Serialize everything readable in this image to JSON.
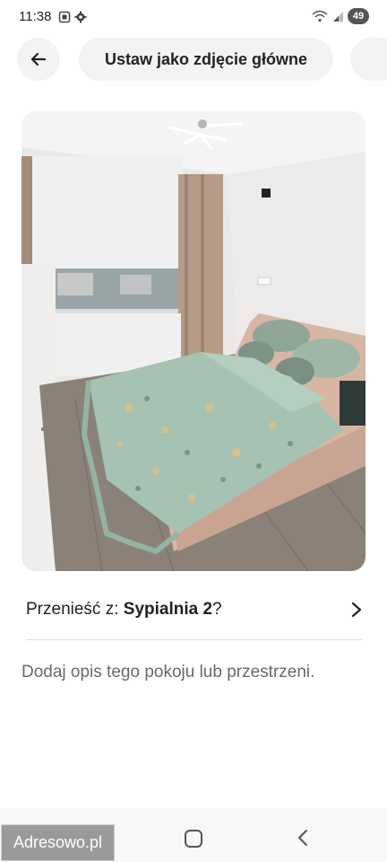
{
  "status": {
    "time": "11:38",
    "battery": "49"
  },
  "toolbar": {
    "main_button_label": "Ustaw jako zdjęcie główne"
  },
  "move": {
    "prefix": "Przenieść z: ",
    "room": "Sypialnia 2",
    "suffix": "?"
  },
  "description_prompt": "Dodaj opis tego pokoju lub przestrzeni.",
  "watermark": "Adresowo.pl",
  "icons": {
    "back": "arrow-left-icon",
    "chevron": "chevron-right-icon",
    "home": "home-square-icon",
    "nav_back": "chevron-left-icon"
  }
}
